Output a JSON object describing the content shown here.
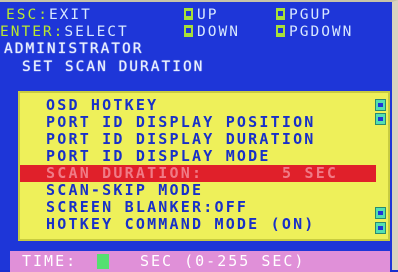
{
  "hints": {
    "esc_key": "ESC",
    "esc_label": "EXIT",
    "enter_key": "ENTER",
    "enter_label": "SELECT",
    "up_label": "UP",
    "down_label": "DOWN",
    "pgup_label": "PGUP",
    "pgdown_label": "PGDOWN"
  },
  "header": {
    "role": "ADMINISTRATOR",
    "title": "SET SCAN DURATION"
  },
  "menu": {
    "items": [
      {
        "label": "OSD HOTKEY",
        "value": ""
      },
      {
        "label": "PORT ID DISPLAY POSITION",
        "value": ""
      },
      {
        "label": "PORT ID DISPLAY DURATION",
        "value": ""
      },
      {
        "label": "PORT ID DISPLAY MODE",
        "value": ""
      },
      {
        "label": "SCAN DURATION:",
        "value": "5 SEC"
      },
      {
        "label": "SCAN-SKIP MODE",
        "value": ""
      },
      {
        "label": "SCREEN BLANKER:OFF",
        "value": ""
      },
      {
        "label": "HOTKEY COMMAND MODE (ON)",
        "value": ""
      }
    ],
    "selected_index": 4
  },
  "footer": {
    "time_label": "TIME:",
    "time_value": "",
    "range_label": "SEC (0-255 SEC)"
  },
  "colors": {
    "background": "#1e36d8",
    "panel": "#eef05a",
    "selected_row": "#e0202a",
    "key_accent": "#a8e038",
    "footer": "#e090d8"
  }
}
